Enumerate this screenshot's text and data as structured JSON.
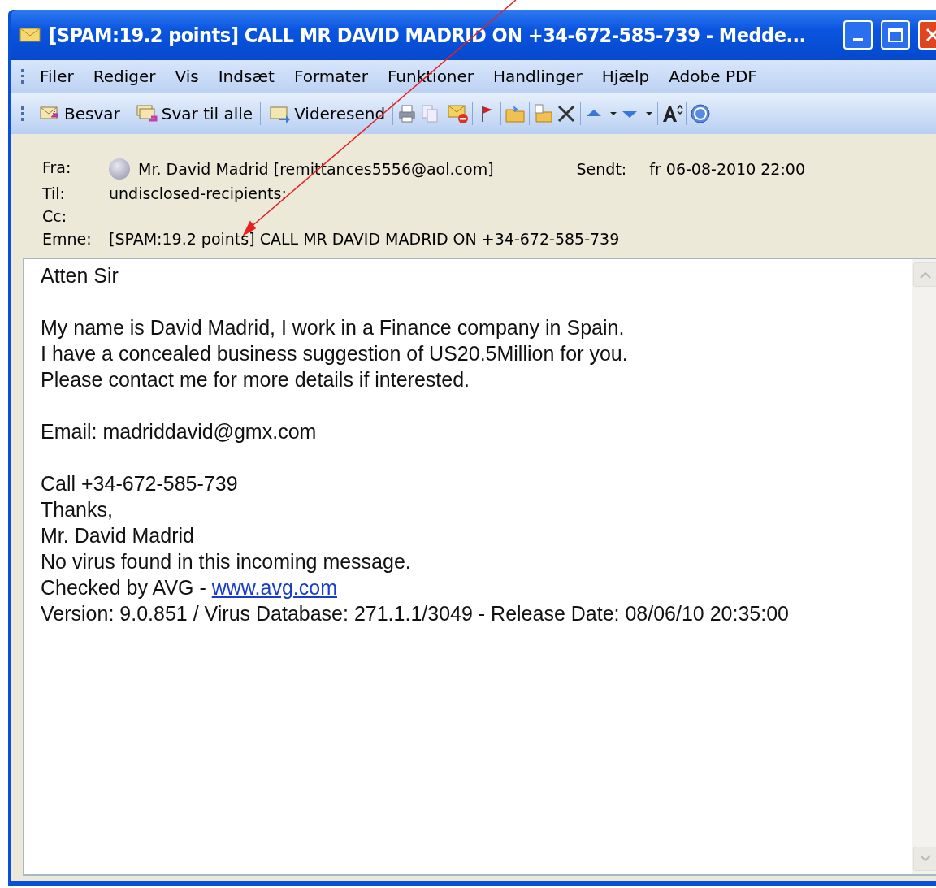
{
  "window": {
    "title": "[SPAM:19.2 points] CALL MR DAVID MADRID ON +34-672-585-739  - Medde..."
  },
  "menu": [
    "Filer",
    "Rediger",
    "Vis",
    "Indsæt",
    "Formater",
    "Funktioner",
    "Handlinger",
    "Hjælp",
    "Adobe PDF"
  ],
  "toolbar": [
    {
      "kind": "reply",
      "label": "Besvar"
    },
    {
      "kind": "reply-all",
      "label": "Svar til alle"
    },
    {
      "kind": "forward",
      "label": "Videresend"
    },
    {
      "kind": "print"
    },
    {
      "kind": "copy"
    },
    {
      "kind": "junk"
    },
    {
      "kind": "flag"
    },
    {
      "kind": "folder"
    },
    {
      "kind": "move"
    },
    {
      "kind": "delete"
    },
    {
      "kind": "up"
    },
    {
      "kind": "down"
    },
    {
      "kind": "font"
    },
    {
      "kind": "help"
    }
  ],
  "header": {
    "from_label": "Fra:",
    "from": "Mr. David Madrid [remittances5556@aol.com]",
    "sent_label": "Sendt:",
    "sent": "fr 06-08-2010 22:00",
    "to_label": "Til:",
    "to": "undisclosed-recipients:",
    "cc_label": "Cc:",
    "subject_label": "Emne:",
    "subject": "[SPAM:19.2 points] CALL MR DAVID MADRID ON +34-672-585-739"
  },
  "body": [
    [
      "Atten Sir"
    ],
    [
      "My name is David Madrid, I work in a Finance company in Spain.",
      "I have a concealed business suggestion of US20.5Million for you.",
      "Please contact me for more details if interested."
    ],
    [
      "Email: madriddavid@gmx.com"
    ],
    [
      "Call +34-672-585-739",
      "Thanks,",
      "Mr. David Madrid",
      "No virus found in this incoming message.",
      {
        "text": "Checked by AVG - ",
        "link": "www.avg.com"
      },
      "Version: 9.0.851 / Virus Database: 271.1.1/3049 - Release Date: 08/06/10 20:35:00"
    ]
  ]
}
